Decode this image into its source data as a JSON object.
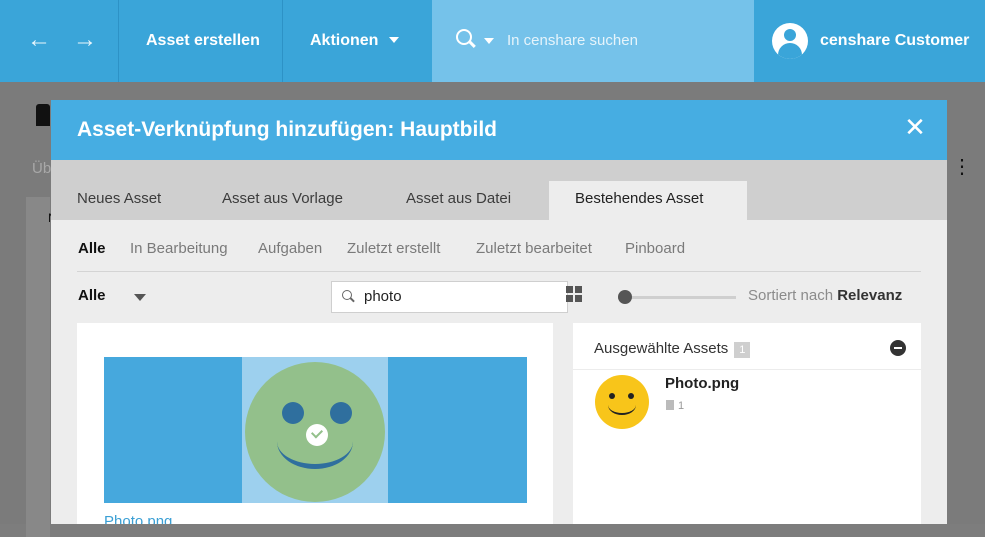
{
  "topbar": {
    "create_asset": "Asset erstellen",
    "actions": "Aktionen",
    "search_placeholder": "In censhare suchen",
    "user_name": "censhare Customer"
  },
  "background": {
    "fragment_text": "Üb",
    "fragment_letter": "N"
  },
  "dialog": {
    "title": "Asset-Verknüpfung hinzufügen: Hauptbild",
    "tabs": [
      "Neues Asset",
      "Asset aus Vorlage",
      "Asset aus Datei",
      "Bestehendes Asset"
    ],
    "active_tab": "Bestehendes Asset",
    "filters": [
      "Alle",
      "In Bearbeitung",
      "Aufgaben",
      "Zuletzt erstellt",
      "Zuletzt bearbeitet",
      "Pinboard"
    ],
    "active_filter": "Alle",
    "type_select": "Alle",
    "search_value": "photo",
    "sort_prefix": "Sortiert nach",
    "sort_value": "Relevanz",
    "results": [
      {
        "name": "Photo.png"
      }
    ],
    "selected_panel": {
      "title": "Ausgewählte Assets",
      "count": "1",
      "items": [
        {
          "name": "Photo.png",
          "meta": "1"
        }
      ]
    }
  },
  "colors": {
    "topbar": "#3aa5d9",
    "dialog_header": "#46ade2",
    "link": "#3a9fd4"
  }
}
